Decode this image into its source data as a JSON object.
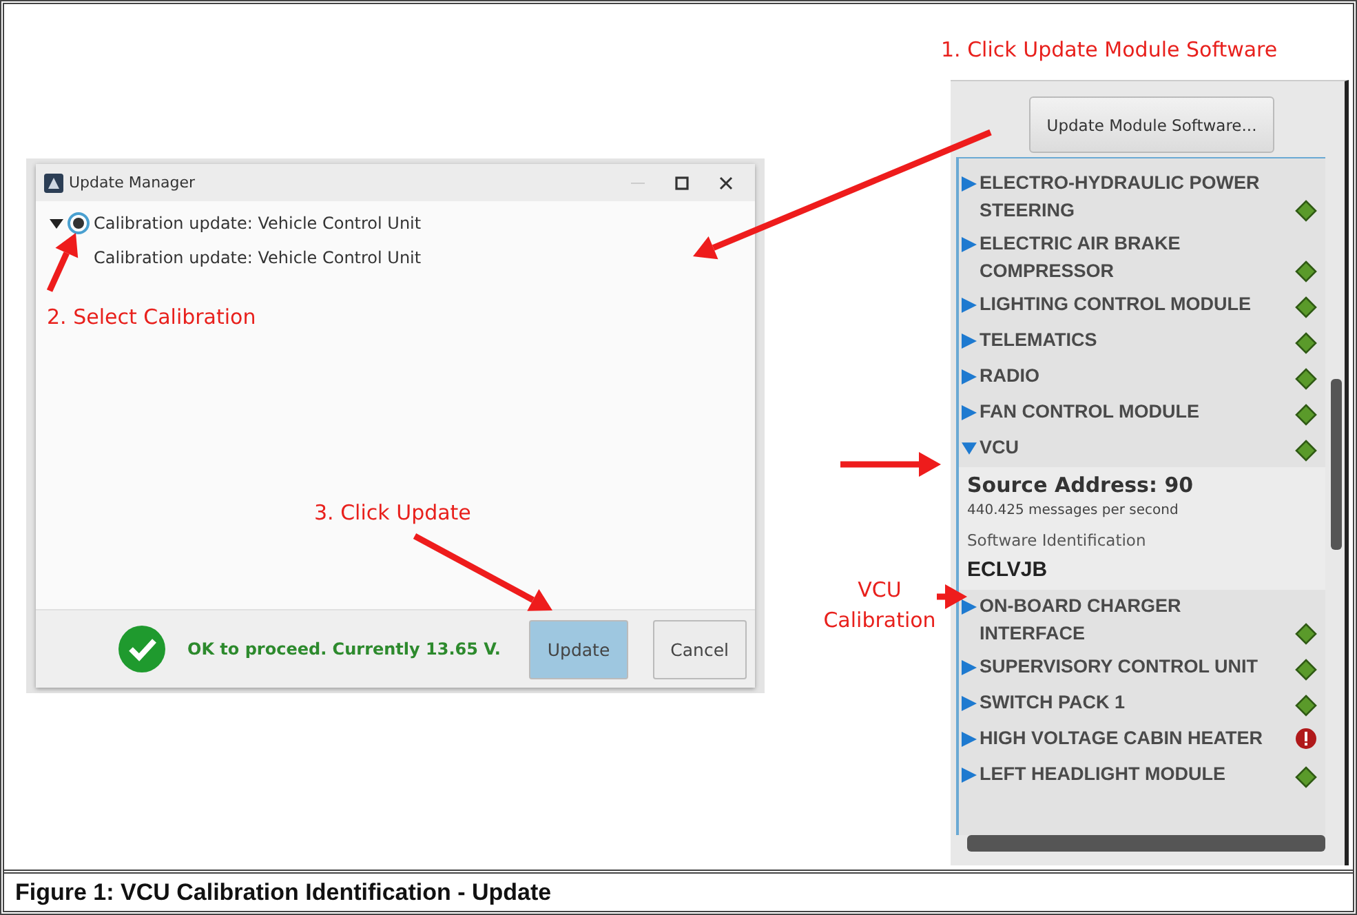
{
  "annotations": [
    {
      "text": "1. Click Update Module Software"
    },
    {
      "text": "2. Select Calibration"
    },
    {
      "text": "3. Click Update"
    },
    {
      "text": "VCU Calibration"
    }
  ],
  "dialog": {
    "title": "Update Manager",
    "tree": [
      {
        "label": "Calibration update: Vehicle Control Unit",
        "expanded": true,
        "selected": true,
        "children": [
          {
            "label": "Calibration update: Vehicle Control Unit"
          }
        ]
      }
    ],
    "status": {
      "text": "OK to proceed. Currently 13.65 V.",
      "ok": true
    },
    "buttons": [
      {
        "label": "Update",
        "kind": "primary"
      },
      {
        "label": "Cancel",
        "kind": "secondary"
      }
    ]
  },
  "module_panel": {
    "button": "Update Module Software...",
    "modules": [
      {
        "name": "ELECTRO-HYDRAULIC POWER STEERING",
        "expanded": false,
        "fault": false
      },
      {
        "name": "ELECTRIC AIR BRAKE COMPRESSOR",
        "expanded": false,
        "fault": false
      },
      {
        "name": "LIGHTING CONTROL MODULE",
        "expanded": false,
        "fault": false
      },
      {
        "name": "TELEMATICS",
        "expanded": false,
        "fault": false
      },
      {
        "name": "RADIO",
        "expanded": false,
        "fault": false
      },
      {
        "name": "FAN CONTROL MODULE",
        "expanded": false,
        "fault": false
      },
      {
        "name": "VCU",
        "expanded": true,
        "fault": false,
        "details": {
          "source_address": "Source Address: 90",
          "rate": "440.425 messages per second",
          "software_label": "Software Identification",
          "software_id": "ECLVJB"
        }
      },
      {
        "name": "ON-BOARD CHARGER INTERFACE",
        "expanded": false,
        "fault": false
      },
      {
        "name": "SUPERVISORY CONTROL UNIT",
        "expanded": false,
        "fault": false
      },
      {
        "name": "SWITCH PACK 1",
        "expanded": false,
        "fault": false
      },
      {
        "name": "HIGH VOLTAGE CABIN HEATER",
        "expanded": false,
        "fault": true
      },
      {
        "name": "LEFT HEADLIGHT MODULE",
        "expanded": false,
        "fault": false
      }
    ]
  },
  "caption": "Figure 1: VCU Calibration Identification - Update"
}
